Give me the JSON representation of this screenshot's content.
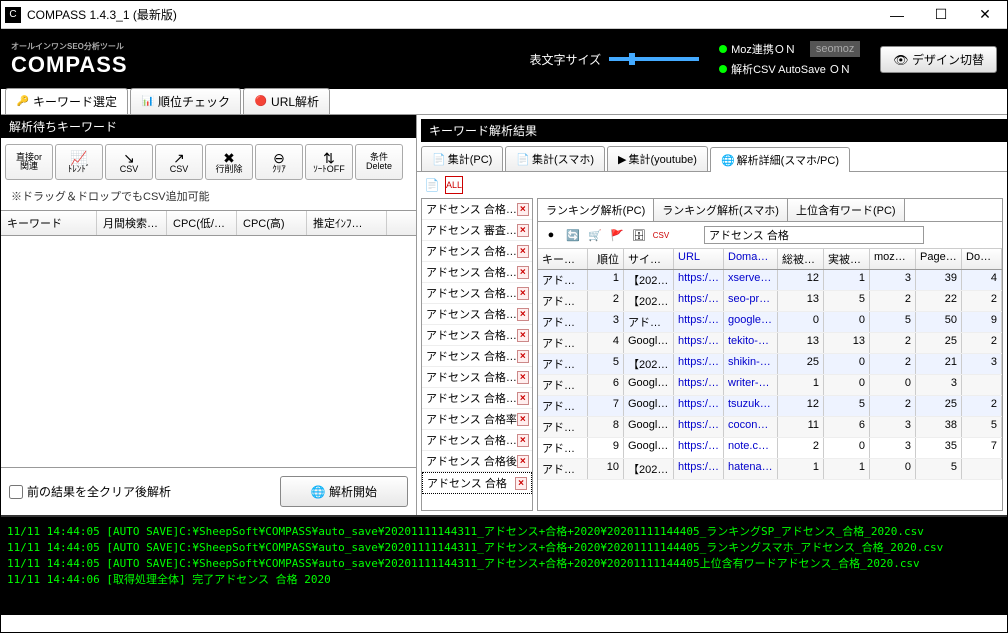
{
  "window": {
    "title": "COMPASS 1.4.3_1 (最新版)"
  },
  "header": {
    "logo_main": "COMPASS",
    "logo_sub": "オールインワンSEO分析ツール",
    "font_size_label": "表文字サイズ",
    "moz_status": "Moz連携ＯＮ",
    "csv_status": "解析CSV AutoSave ＯＮ",
    "seomoz": "seomoz",
    "design_btn": "デザイン切替"
  },
  "main_tabs": [
    {
      "label": "キーワード選定",
      "icon": "🔑"
    },
    {
      "label": "順位チェック",
      "icon": "📊"
    },
    {
      "label": "URL解析",
      "icon": "🔴"
    }
  ],
  "left": {
    "header": "解析待ちキーワード",
    "toolbar": [
      {
        "name": "direct-btn",
        "label": "直接or\n関連"
      },
      {
        "name": "trend-btn",
        "label": "ﾄﾚﾝﾄﾞ",
        "icon": "📈"
      },
      {
        "name": "csv-down-btn",
        "label": "CSV",
        "icon": "↘"
      },
      {
        "name": "csv-up-btn",
        "label": "CSV",
        "icon": "↗"
      },
      {
        "name": "row-del-btn",
        "label": "行削除",
        "icon": "✖"
      },
      {
        "name": "clear-btn",
        "label": "ｸﾘｱ",
        "icon": "⊖"
      },
      {
        "name": "sort-off-btn",
        "label": "ｿｰﾄOFF",
        "icon": "⇅"
      },
      {
        "name": "cond-del-btn",
        "label": "条件\nDelete"
      }
    ],
    "note": "※ドラッグ＆ドロップでもCSV追加可能",
    "grid_cols": [
      "キーワード",
      "月間検索…",
      "CPC(低/…",
      "CPC(高)",
      "推定ｲﾝﾌ…"
    ],
    "clear_chk": "前の結果を全クリア後解析",
    "analyze_btn": "解析開始"
  },
  "right": {
    "header": "キーワード解析結果",
    "subtabs": [
      {
        "label": "集計(PC)",
        "icon": "📄"
      },
      {
        "label": "集計(スマホ)",
        "icon": "📄"
      },
      {
        "label": "集計(youtube)",
        "icon": "▶"
      },
      {
        "label": "解析詳細(スマホ/PC)",
        "icon": "🌐"
      }
    ],
    "kwlist": [
      "アドセンス 合格…",
      "アドセンス 審査…",
      "アドセンス 合格…",
      "アドセンス 合格…",
      "アドセンス 合格…",
      "アドセンス 合格…",
      "アドセンス 合格…",
      "アドセンス 合格…",
      "アドセンス 合格…",
      "アドセンス 合格…",
      "アドセンス 合格率",
      "アドセンス 合格…",
      "アドセンス 合格後",
      "アドセンス 合格"
    ],
    "detail_tabs": [
      "ランキング解析(PC)",
      "ランキング解析(スマホ)",
      "上位含有ワード(PC)"
    ],
    "detail_input": "アドセンス 合格",
    "grid_cols": [
      "キーワ…",
      "順位",
      "サイトタ…",
      "URL",
      "Doma…",
      "総被リ…",
      "実被リ…",
      "mozR…",
      "Page …",
      "Doma…"
    ],
    "rows": [
      {
        "kw": "アドセン…",
        "rank": 1,
        "title": "【2020…",
        "url": "https:/…",
        "dom": "xserver.…",
        "t": 12,
        "r": 1,
        "m": 3,
        "p": 39,
        "d": "4"
      },
      {
        "kw": "アドセン…",
        "rank": 2,
        "title": "【2020…",
        "url": "https:/…",
        "dom": "seo-pr…",
        "t": 13,
        "r": 5,
        "m": 2,
        "p": 22,
        "d": "2"
      },
      {
        "kw": "アドセン…",
        "rank": 3,
        "title": "アドセン…",
        "url": "https:/…",
        "dom": "google…",
        "t": 0,
        "r": 0,
        "m": 5,
        "p": 50,
        "d": "9"
      },
      {
        "kw": "アドセン…",
        "rank": 4,
        "title": "Google…",
        "url": "https:/…",
        "dom": "tekito-…",
        "t": 13,
        "r": 13,
        "m": 2,
        "p": 25,
        "d": "2"
      },
      {
        "kw": "アドセン…",
        "rank": 5,
        "title": "【2020…",
        "url": "https:/…",
        "dom": "shikin-…",
        "t": 25,
        "r": 0,
        "m": 2,
        "p": 21,
        "d": "3"
      },
      {
        "kw": "アドセン…",
        "rank": 6,
        "title": "Google…",
        "url": "https:/…",
        "dom": "writer-…",
        "t": 1,
        "r": 0,
        "m": 0,
        "p": 3,
        "d": ""
      },
      {
        "kw": "アドセン…",
        "rank": 7,
        "title": "Google…",
        "url": "https:/…",
        "dom": "tsuzuki…",
        "t": 12,
        "r": 5,
        "m": 2,
        "p": 25,
        "d": "2"
      },
      {
        "kw": "アドセン…",
        "rank": 8,
        "title": "Google…",
        "url": "https:/…",
        "dom": "cocona…",
        "t": 11,
        "r": 6,
        "m": 3,
        "p": 38,
        "d": "5"
      },
      {
        "kw": "アドセン…",
        "rank": 9,
        "title": "Google…",
        "url": "https:/…",
        "dom": "note.co…",
        "t": 2,
        "r": 0,
        "m": 3,
        "p": 35,
        "d": "7"
      },
      {
        "kw": "アドセン…",
        "rank": 10,
        "title": "【2020…",
        "url": "https:/…",
        "dom": "hatena…",
        "t": 1,
        "r": 1,
        "m": 0,
        "p": 5,
        "d": ""
      }
    ]
  },
  "console": [
    "11/11 14:44:05 [AUTO SAVE]C:¥SheepSoft¥COMPASS¥auto_save¥20201111144311_アドセンス+合格+2020¥20201111144405_ランキングSP_アドセンス_合格_2020.csv",
    "11/11 14:44:05 [AUTO SAVE]C:¥SheepSoft¥COMPASS¥auto_save¥20201111144311_アドセンス+合格+2020¥20201111144405_ランキングスマホ_アドセンス_合格_2020.csv",
    "11/11 14:44:05 [AUTO SAVE]C:¥SheepSoft¥COMPASS¥auto_save¥20201111144311_アドセンス+合格+2020¥20201111144405上位含有ワードアドセンス_合格_2020.csv",
    "11/11 14:44:06 [取得処理全体] 完了アドセンス 合格 2020"
  ]
}
